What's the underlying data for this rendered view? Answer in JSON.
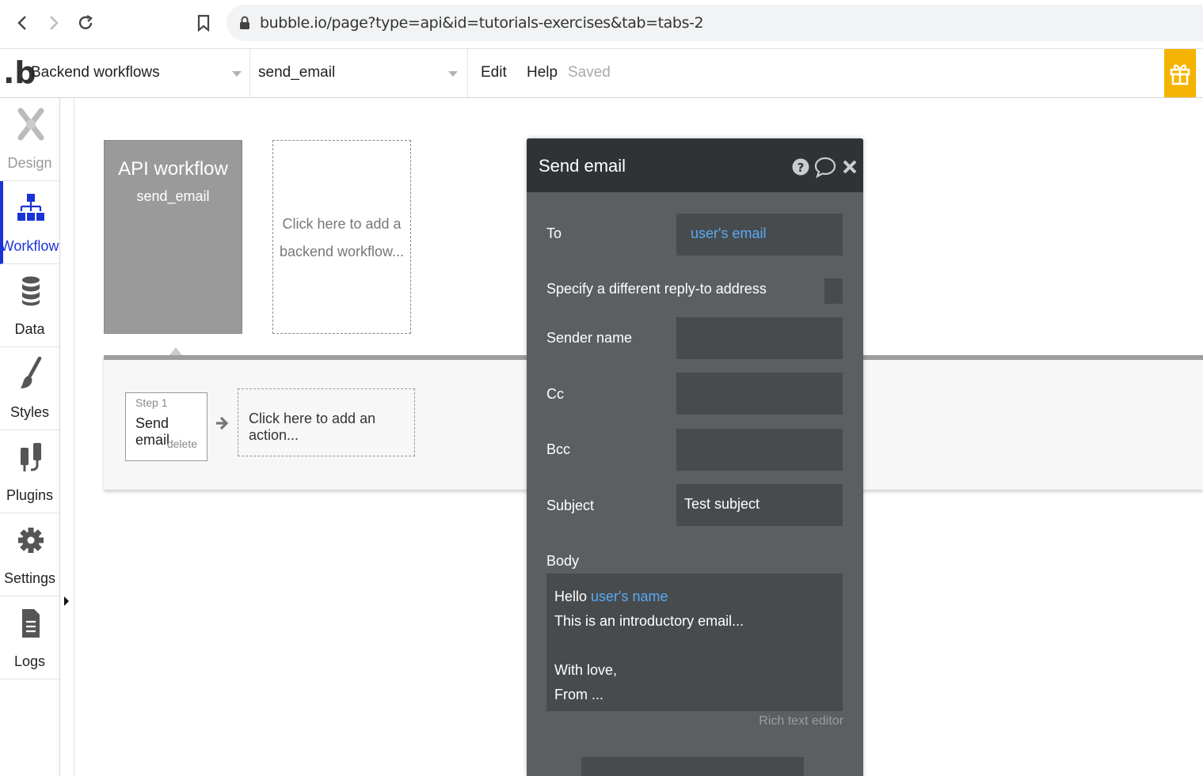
{
  "browser": {
    "url": "bubble.io/page?type=api&id=tutorials-exercises&tab=tabs-2"
  },
  "app_bar": {
    "logo": ".b",
    "page_dropdown": "Backend workflows",
    "workflow_dropdown": "send_email",
    "menu_edit": "Edit",
    "menu_help": "Help",
    "status": "Saved",
    "accent_color": "#f5b301"
  },
  "sidebar": {
    "items": [
      {
        "label": "Design",
        "icon": "design-icon"
      },
      {
        "label": "Workflow",
        "icon": "workflow-icon"
      },
      {
        "label": "Data",
        "icon": "database-icon"
      },
      {
        "label": "Styles",
        "icon": "brush-icon"
      },
      {
        "label": "Plugins",
        "icon": "plug-icon"
      },
      {
        "label": "Settings",
        "icon": "gear-icon"
      },
      {
        "label": "Logs",
        "icon": "document-icon"
      }
    ],
    "active_color": "#1a33d6"
  },
  "canvas": {
    "workflow_card": {
      "title": "API workflow",
      "name": "send_email"
    },
    "add_workflow_line1": "Click here to add a",
    "add_workflow_line2": "backend workflow...",
    "step": {
      "number": "Step 1",
      "name": "Send email",
      "delete": "delete"
    },
    "add_action": "Click here to add an action..."
  },
  "editor": {
    "title": "Send email",
    "fields": {
      "to_label": "To",
      "to_value": "user's email",
      "reply_to_label": "Specify a different reply-to address",
      "sender_label": "Sender name",
      "sender_value": "",
      "cc_label": "Cc",
      "cc_value": "",
      "bcc_label": "Bcc",
      "bcc_value": "",
      "subject_label": "Subject",
      "subject_value": "Test subject",
      "body_label": "Body"
    },
    "body": {
      "line1_prefix": "Hello ",
      "line1_dynamic": "user's name",
      "line2": "This is an introductory email...",
      "line3": "",
      "line4": "With love,",
      "line5": "From ..."
    },
    "rich_text_label": "Rich text editor",
    "dynamic_color": "#5aa9f4"
  }
}
